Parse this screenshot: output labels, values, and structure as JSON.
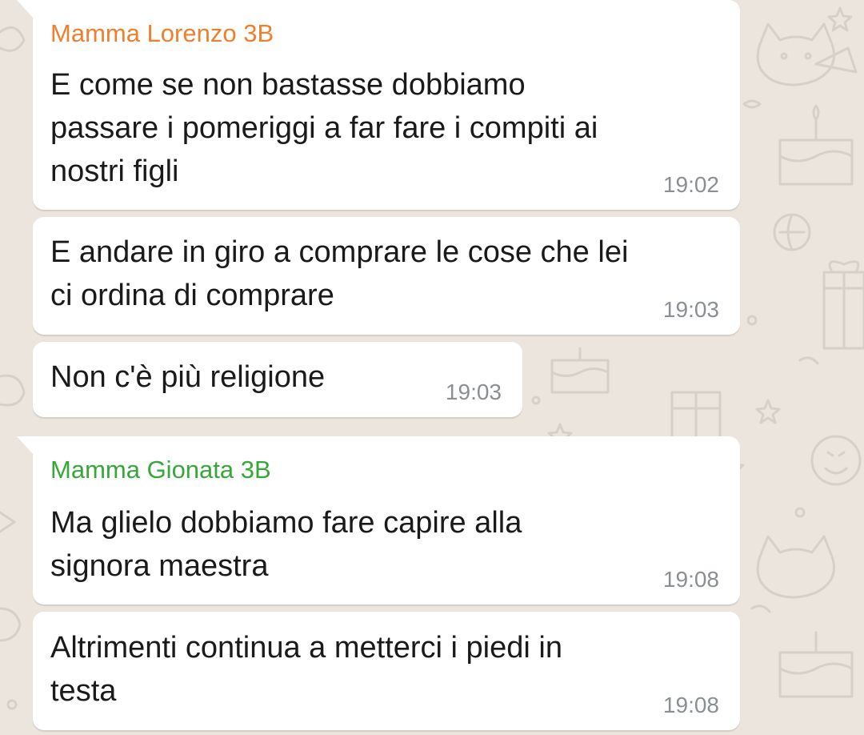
{
  "chat": {
    "wallpaper_color": "#ece5dd",
    "bubble_color": "#ffffff",
    "messages": [
      {
        "sender": "Mamma Lorenzo 3B",
        "sender_color": "#f07f2d",
        "lines": [
          "E come se non bastasse dobbiamo",
          "passare i pomeriggi a far fare i compiti ai",
          "nostri figli"
        ],
        "time": "19:02"
      },
      {
        "lines": [
          "E andare in giro a comprare le cose che lei",
          "ci ordina di comprare"
        ],
        "time": "19:03"
      },
      {
        "lines": [
          "Non c'è più religione"
        ],
        "time": "19:03"
      },
      {
        "sender": "Mamma Gionata 3B",
        "sender_color": "#35a838",
        "lines": [
          "Ma glielo dobbiamo fare capire alla",
          "signora maestra"
        ],
        "time": "19:08"
      },
      {
        "lines": [
          "Altrimenti continua a metterci i piedi in",
          "testa"
        ],
        "time": "19:08"
      }
    ]
  }
}
